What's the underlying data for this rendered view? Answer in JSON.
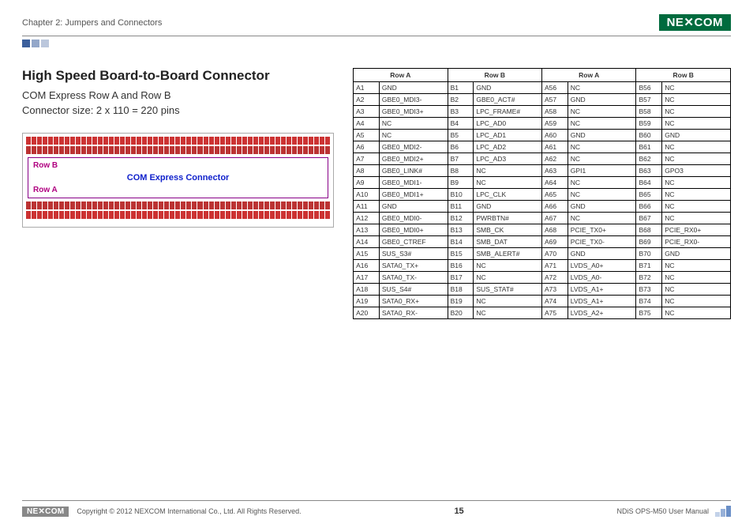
{
  "header": {
    "chapter": "Chapter 2: Jumpers and Connectors",
    "brand": "NE✕COM"
  },
  "section": {
    "title": "High Speed Board-to-Board Connector",
    "line1": "COM Express Row A and Row B",
    "line2": "Connector size: 2 x 110 = 220 pins"
  },
  "diagram": {
    "row_b": "Row B",
    "row_a": "Row A",
    "center": "COM Express Connector"
  },
  "table": {
    "headers": [
      "Row A",
      "Row B",
      "Row A",
      "Row B"
    ],
    "rows": [
      [
        "A1",
        "GND",
        "B1",
        "GND",
        "A56",
        "NC",
        "B56",
        "NC"
      ],
      [
        "A2",
        "GBE0_MDI3-",
        "B2",
        "GBE0_ACT#",
        "A57",
        "GND",
        "B57",
        "NC"
      ],
      [
        "A3",
        "GBE0_MDI3+",
        "B3",
        "LPC_FRAME#",
        "A58",
        "NC",
        "B58",
        "NC"
      ],
      [
        "A4",
        "NC",
        "B4",
        "LPC_AD0",
        "A59",
        "NC",
        "B59",
        "NC"
      ],
      [
        "A5",
        "NC",
        "B5",
        "LPC_AD1",
        "A60",
        "GND",
        "B60",
        "GND"
      ],
      [
        "A6",
        "GBE0_MDI2-",
        "B6",
        "LPC_AD2",
        "A61",
        "NC",
        "B61",
        "NC"
      ],
      [
        "A7",
        "GBE0_MDI2+",
        "B7",
        "LPC_AD3",
        "A62",
        "NC",
        "B62",
        "NC"
      ],
      [
        "A8",
        "GBE0_LINK#",
        "B8",
        "NC",
        "A63",
        "GPI1",
        "B63",
        "GPO3"
      ],
      [
        "A9",
        "GBE0_MDI1-",
        "B9",
        "NC",
        "A64",
        "NC",
        "B64",
        "NC"
      ],
      [
        "A10",
        "GBE0_MDI1+",
        "B10",
        "LPC_CLK",
        "A65",
        "NC",
        "B65",
        "NC"
      ],
      [
        "A11",
        "GND",
        "B11",
        "GND",
        "A66",
        "GND",
        "B66",
        "NC"
      ],
      [
        "A12",
        "GBE0_MDI0-",
        "B12",
        "PWRBTN#",
        "A67",
        "NC",
        "B67",
        "NC"
      ],
      [
        "A13",
        "GBE0_MDI0+",
        "B13",
        "SMB_CK",
        "A68",
        "PCIE_TX0+",
        "B68",
        "PCIE_RX0+"
      ],
      [
        "A14",
        "GBE0_CTREF",
        "B14",
        "SMB_DAT",
        "A69",
        "PCIE_TX0-",
        "B69",
        "PCIE_RX0-"
      ],
      [
        "A15",
        "SUS_S3#",
        "B15",
        "SMB_ALERT#",
        "A70",
        "GND",
        "B70",
        "GND"
      ],
      [
        "A16",
        "SATA0_TX+",
        "B16",
        "NC",
        "A71",
        "LVDS_A0+",
        "B71",
        "NC"
      ],
      [
        "A17",
        "SATA0_TX-",
        "B17",
        "NC",
        "A72",
        "LVDS_A0-",
        "B72",
        "NC"
      ],
      [
        "A18",
        "SUS_S4#",
        "B18",
        "SUS_STAT#",
        "A73",
        "LVDS_A1+",
        "B73",
        "NC"
      ],
      [
        "A19",
        "SATA0_RX+",
        "B19",
        "NC",
        "A74",
        "LVDS_A1+",
        "B74",
        "NC"
      ],
      [
        "A20",
        "SATA0_RX-",
        "B20",
        "NC",
        "A75",
        "LVDS_A2+",
        "B75",
        "NC"
      ]
    ]
  },
  "footer": {
    "brand_sm": "NE✕COM",
    "copyright": "Copyright © 2012 NEXCOM International Co., Ltd. All Rights Reserved.",
    "page": "15",
    "doc": "NDiS OPS-M50 User Manual"
  }
}
